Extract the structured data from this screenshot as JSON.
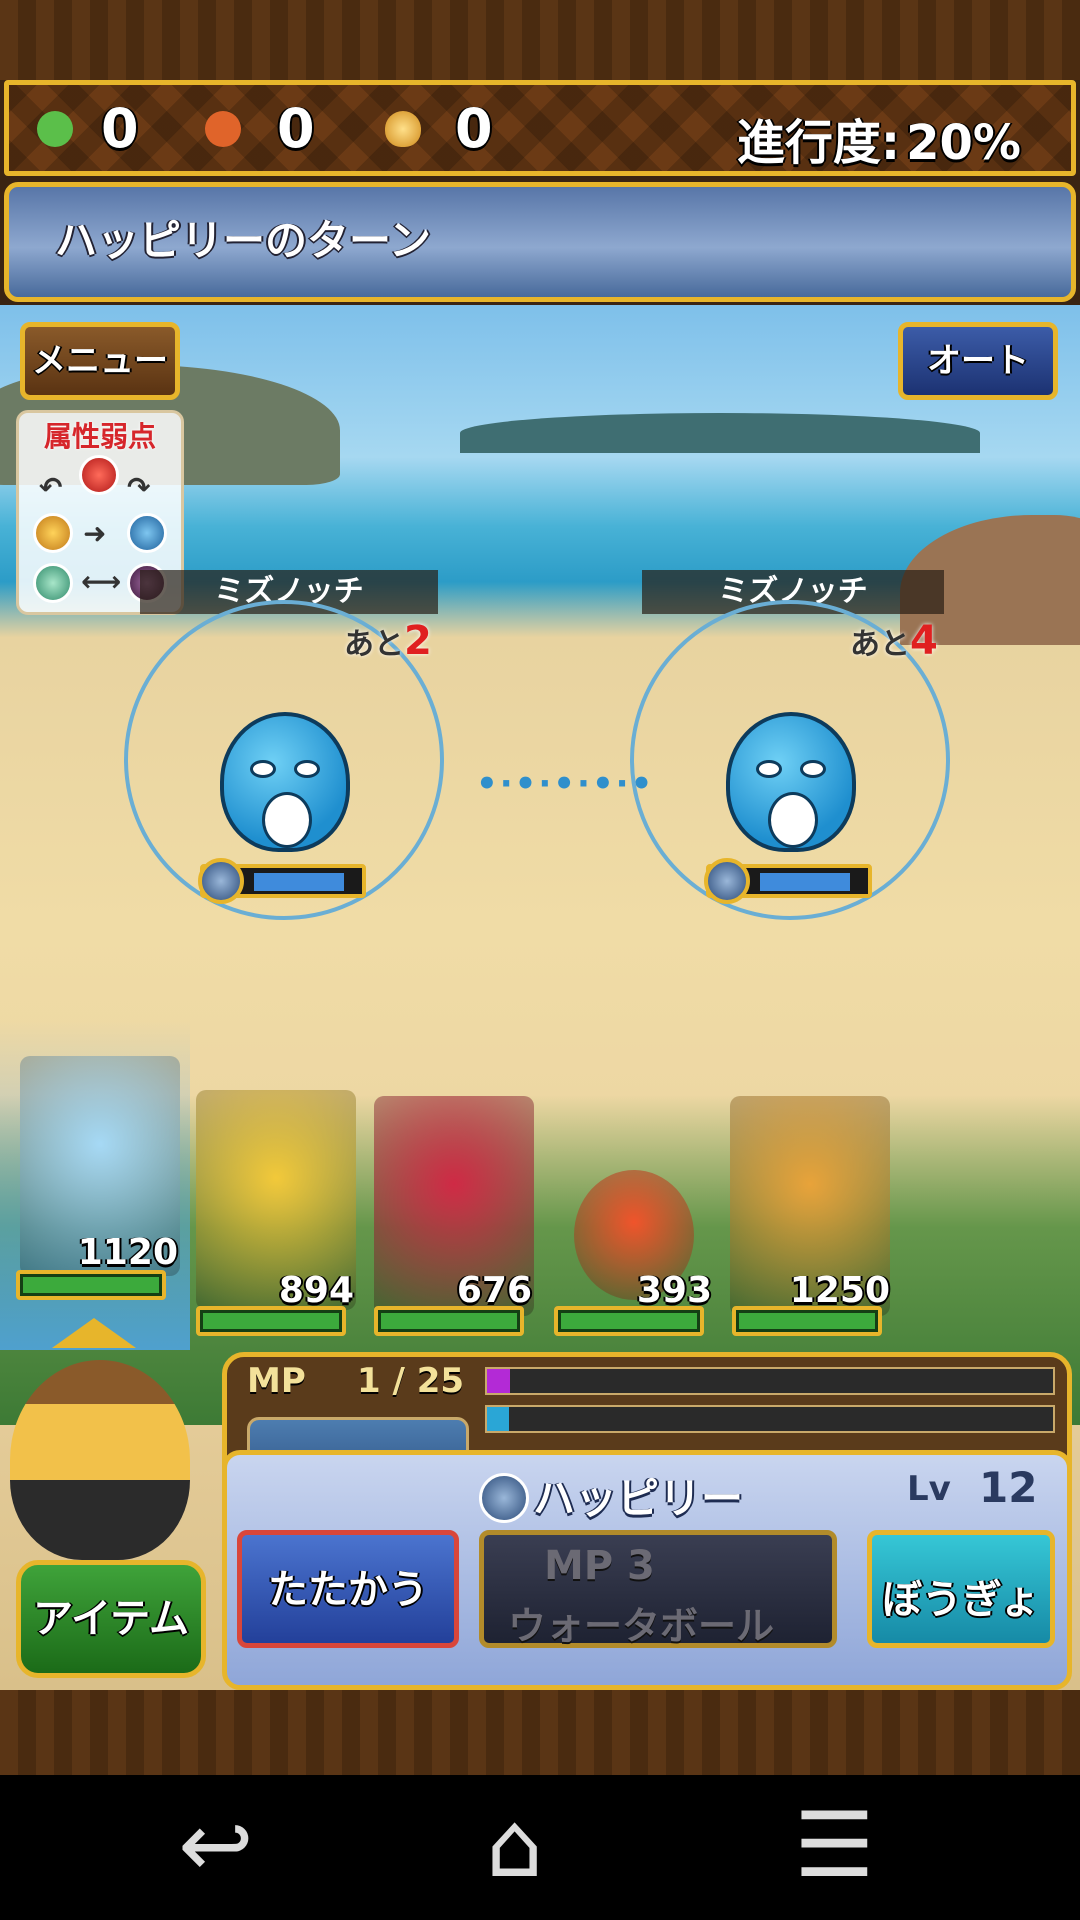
{
  "status_bar": {
    "gold_icon": "dragon-head-icon",
    "gold": "0",
    "bag_icon": "money-bag-icon",
    "bag": "0",
    "egg_icon": "egg-icon",
    "egg": "0",
    "progress_label": "進行度:",
    "progress_value": "20%",
    "progress_fraction": 0.2
  },
  "turn_banner": {
    "text": "ハッピリーのターン"
  },
  "buttons": {
    "menu": "メニュー",
    "auto": "オート"
  },
  "weakness_panel": {
    "title": "属性弱点",
    "elements": [
      "fire-icon",
      "water-icon",
      "earth-icon",
      "wind-icon",
      "dark-icon"
    ],
    "arrows": [
      "↶",
      "↷",
      "➜",
      "⟷"
    ]
  },
  "enemies": [
    {
      "name": "ミズノッチ",
      "turns_prefix": "あと",
      "turns": "2",
      "hp_fraction": 0.9
    },
    {
      "name": "ミズノッチ",
      "turns_prefix": "あと",
      "turns": "4",
      "hp_fraction": 0.9
    }
  ],
  "target_dots": "•·•·•·•·•",
  "party": [
    {
      "name": "fairy-girl",
      "hp": "1120",
      "hp_fraction": 1.0,
      "color": "#a6d9f5"
    },
    {
      "name": "yellow-dragon",
      "hp": "894",
      "hp_fraction": 1.0,
      "color": "#f2c93a"
    },
    {
      "name": "red-horse",
      "hp": "676",
      "hp_fraction": 1.0,
      "color": "#cf2a45"
    },
    {
      "name": "red-blob",
      "hp": "393",
      "hp_fraction": 1.0,
      "color": "#f0542b"
    },
    {
      "name": "bone-dragon",
      "hp": "1250",
      "hp_fraction": 1.0,
      "color": "#e8a33a"
    }
  ],
  "mp": {
    "label": "MP",
    "value": "1 / 25",
    "fraction": 0.04
  },
  "command": {
    "character_name": "ハッピリー",
    "level_label": "Lv",
    "level": "12",
    "attack": "たたかう",
    "skill_mp": "MP 3",
    "skill_name": "ウォータボール",
    "guard": "ぼうぎょ",
    "item": "アイテム"
  },
  "nav": {
    "back": "↩",
    "home": "⌂",
    "recent": "☰"
  }
}
